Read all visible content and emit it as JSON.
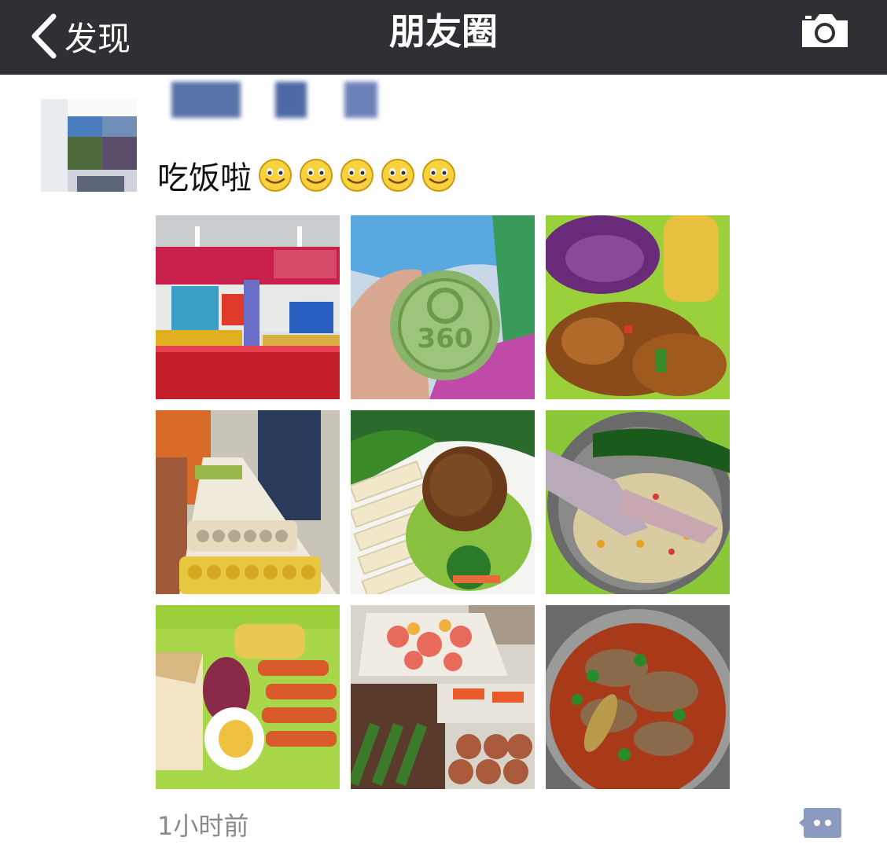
{
  "navbar": {
    "back_label": "发现",
    "title": "朋友圈",
    "background": "#2f3034"
  },
  "post": {
    "text": "吃饭啦",
    "emoji_count": 5,
    "emoji": "smiley-face-icon",
    "time": "1小时前",
    "photos": [
      {
        "name": "photo-banquet-hall"
      },
      {
        "name": "photo-360-mooncake"
      },
      {
        "name": "photo-cabbage-chicken"
      },
      {
        "name": "photo-buffet-table"
      },
      {
        "name": "photo-meatball-plate"
      },
      {
        "name": "photo-fried-rice-bowl"
      },
      {
        "name": "photo-breakfast-tray"
      },
      {
        "name": "photo-buffet-platters"
      },
      {
        "name": "photo-stew-pot"
      }
    ]
  },
  "colors": {
    "accent": "#576b95",
    "time_text": "#8a8a8a"
  }
}
